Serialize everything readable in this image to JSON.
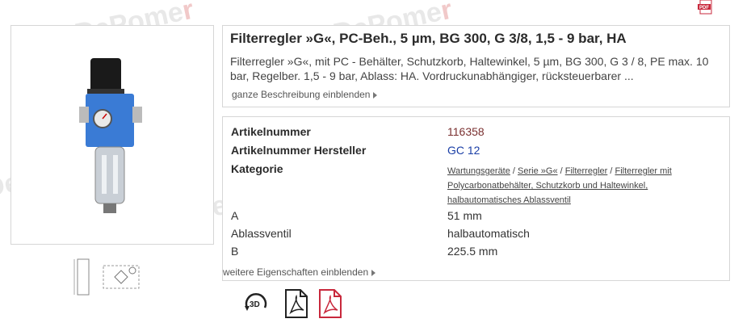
{
  "watermark": {
    "text_a": "DePome",
    "text_b": "r",
    "text_c": "l"
  },
  "product": {
    "title": "Filterregler »G«, PC-Beh., 5 µm, BG 300, G 3/8, 1,5 - 9 bar, HA",
    "description": "Filterregler »G«, mit PC - Behälter, Schutzkorb, Haltewinkel, 5 µm, BG 300, G 3 / 8, PE max. 10 bar, Regelber. 1,5 - 9 bar, Ablass: HA. Vordruckunabhängiger, rücksteuerbarer ...",
    "show_description_label": "ganze Beschreibung einblenden"
  },
  "properties": {
    "rows": [
      {
        "label": "Artikelnummer",
        "value": "116358"
      },
      {
        "label": "Artikelnummer Hersteller",
        "value": "GC 12"
      },
      {
        "label": "Kategorie",
        "value": ""
      },
      {
        "label": "A",
        "value": "51 mm"
      },
      {
        "label": "Ablassventil",
        "value": "halbautomatisch"
      },
      {
        "label": "B",
        "value": "225.5 mm"
      }
    ],
    "category_links": [
      "Wartungsgeräte",
      "Serie »G«",
      "Filterregler",
      "Filterregler mit Polycarbonatbehälter, Schutzkorb und Haltewinkel, halbautomatisches Ablassventil"
    ],
    "category_separator": " / ",
    "show_more_label": "weitere Eigenschaften einblenden"
  },
  "icons": {
    "top_right": "pdf-icon",
    "bottom": [
      "rotate-3d-icon",
      "pdf-outline-icon",
      "pdf-red-icon"
    ],
    "rotate_label": "3D"
  },
  "colors": {
    "article_number": "#7a3030",
    "manufacturer_number": "#1a3ea6",
    "pdf_red": "#c8283c"
  }
}
